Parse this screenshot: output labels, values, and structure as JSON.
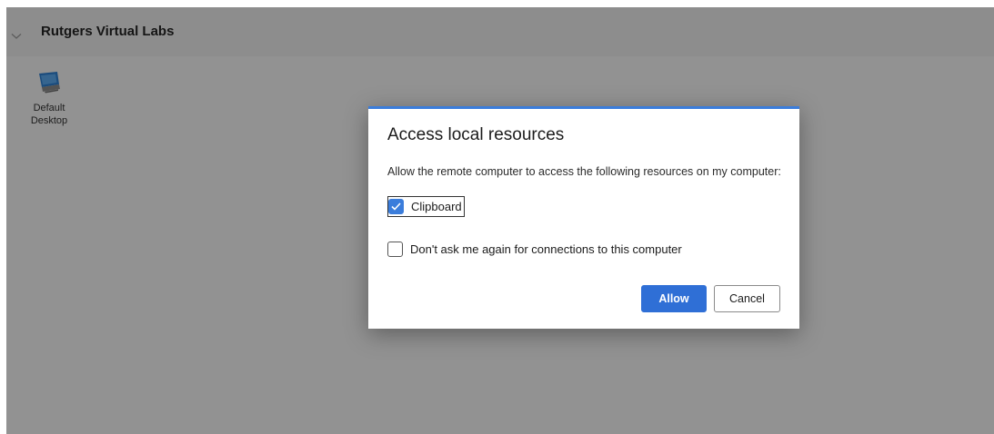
{
  "workspace": {
    "group_title": "Rutgers Virtual Labs",
    "resources": [
      {
        "label": "Default\nDesktop",
        "icon": "desktop-monitor-icon"
      }
    ]
  },
  "dialog": {
    "title": "Access local resources",
    "description": "Allow the remote computer to access the following resources on my computer:",
    "options": [
      {
        "label": "Clipboard",
        "checked": true
      },
      {
        "label": "Don't ask me again for connections to this computer",
        "checked": false
      }
    ],
    "allow_label": "Allow",
    "cancel_label": "Cancel"
  },
  "colors": {
    "accent": "#3b7ddb",
    "primary_button": "#2f6fd6"
  }
}
